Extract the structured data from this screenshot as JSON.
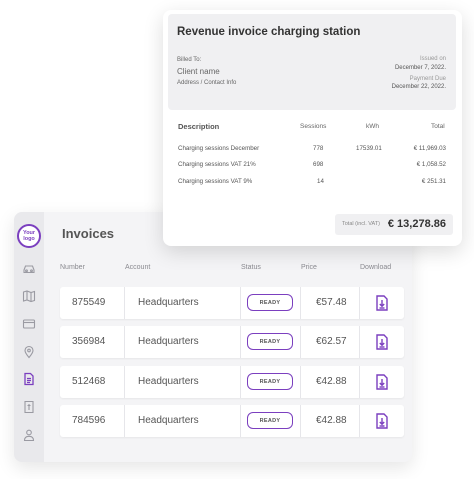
{
  "invoice": {
    "title": "Revenue invoice charging station",
    "billed_to_label": "Billed To:",
    "client_name": "Client name",
    "client_contact": "Address / Contact Info",
    "issued_label": "Issued on",
    "issued_date": "December 7, 2022.",
    "payment_due_label": "Payment Due",
    "payment_due_date": "December 22, 2022.",
    "columns": {
      "description": "Description",
      "sessions": "Sessions",
      "kwh": "kWh",
      "total": "Total"
    },
    "lines": [
      {
        "description": "Charging sessions December",
        "sessions": "778",
        "kwh": "17539.01",
        "total": "€ 11,969.03"
      },
      {
        "description": "Charging sessions VAT 21%",
        "sessions": "698",
        "kwh": "",
        "total": "€ 1,058.52"
      },
      {
        "description": "Charging sessions VAT 9%",
        "sessions": "14",
        "kwh": "",
        "total": "€ 251.31"
      }
    ],
    "total_label": "Total (incl. VAT)",
    "total_value": "€ 13,278.86"
  },
  "panel": {
    "logo_text": "Your logo",
    "title": "Invoices",
    "accent_color": "#7b3fbf",
    "nav_icons": [
      "car-icon",
      "map-icon",
      "card-icon",
      "location-pin-icon",
      "document-icon",
      "receipt-icon",
      "user-icon"
    ],
    "columns": {
      "number": "Number",
      "account": "Account",
      "status": "Status",
      "price": "Price",
      "download": "Download"
    },
    "rows": [
      {
        "number": "875549",
        "account": "Headquarters",
        "status": "READY",
        "price": "€57.48"
      },
      {
        "number": "356984",
        "account": "Headquarters",
        "status": "READY",
        "price": "€62.57"
      },
      {
        "number": "512468",
        "account": "Headquarters",
        "status": "READY",
        "price": "€42.88"
      },
      {
        "number": "784596",
        "account": "Headquarters",
        "status": "READY",
        "price": "€42.88"
      }
    ]
  }
}
